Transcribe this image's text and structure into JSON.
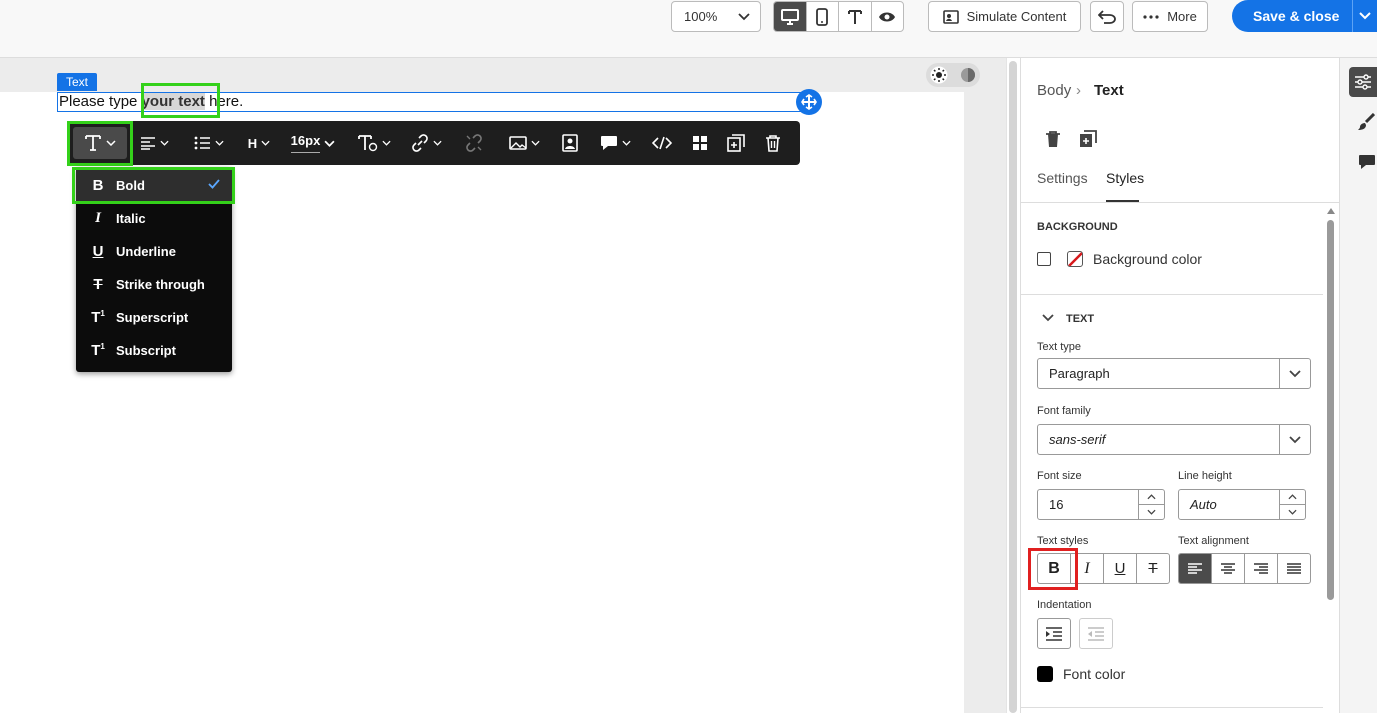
{
  "topbar": {
    "zoom": "100%",
    "view_modes": [
      "desktop-icon",
      "mobile-icon",
      "text-icon",
      "preview-icon"
    ],
    "simulate_label": "Simulate Content",
    "more_label": "More",
    "save_label": "Save & close",
    "colors": {
      "accent": "#1473e6"
    }
  },
  "canvas": {
    "element_tag": "Text",
    "paragraph": {
      "before": "Please type ",
      "bold": "your text",
      "after": " here."
    }
  },
  "toolbar": {
    "font_size": "16px",
    "heading_label": "H",
    "tools": [
      "text-style-icon",
      "align-icon",
      "list-icon",
      "heading-icon",
      "font-size",
      "text-color-icon",
      "link-icon",
      "unlink-icon",
      "image-icon",
      "personalize-icon",
      "comment-icon",
      "code-icon",
      "component-icon",
      "duplicate-icon",
      "delete-icon"
    ]
  },
  "style_menu": {
    "items": [
      {
        "icon": "B",
        "label": "Bold",
        "checked": true
      },
      {
        "icon": "I",
        "label": "Italic"
      },
      {
        "icon": "U",
        "label": "Underline"
      },
      {
        "icon": "T",
        "label": "Strike through"
      },
      {
        "icon": "T",
        "label": "Superscript"
      },
      {
        "icon": "T",
        "label": "Subscript"
      }
    ]
  },
  "panel": {
    "breadcrumb": {
      "parent": "Body",
      "current": "Text"
    },
    "tabs": {
      "settings": "Settings",
      "styles": "Styles",
      "active": "styles"
    },
    "background": {
      "heading": "BACKGROUND",
      "label": "Background color"
    },
    "text": {
      "heading": "TEXT",
      "text_type_label": "Text type",
      "text_type": "Paragraph",
      "font_family_label": "Font family",
      "font_family": "sans-serif",
      "font_size_label": "Font size",
      "font_size": "16",
      "line_height_label": "Line height",
      "line_height": "Auto",
      "text_styles_label": "Text styles",
      "text_alignment_label": "Text alignment",
      "indentation_label": "Indentation",
      "font_color_label": "Font color",
      "font_color": "#000000"
    }
  }
}
